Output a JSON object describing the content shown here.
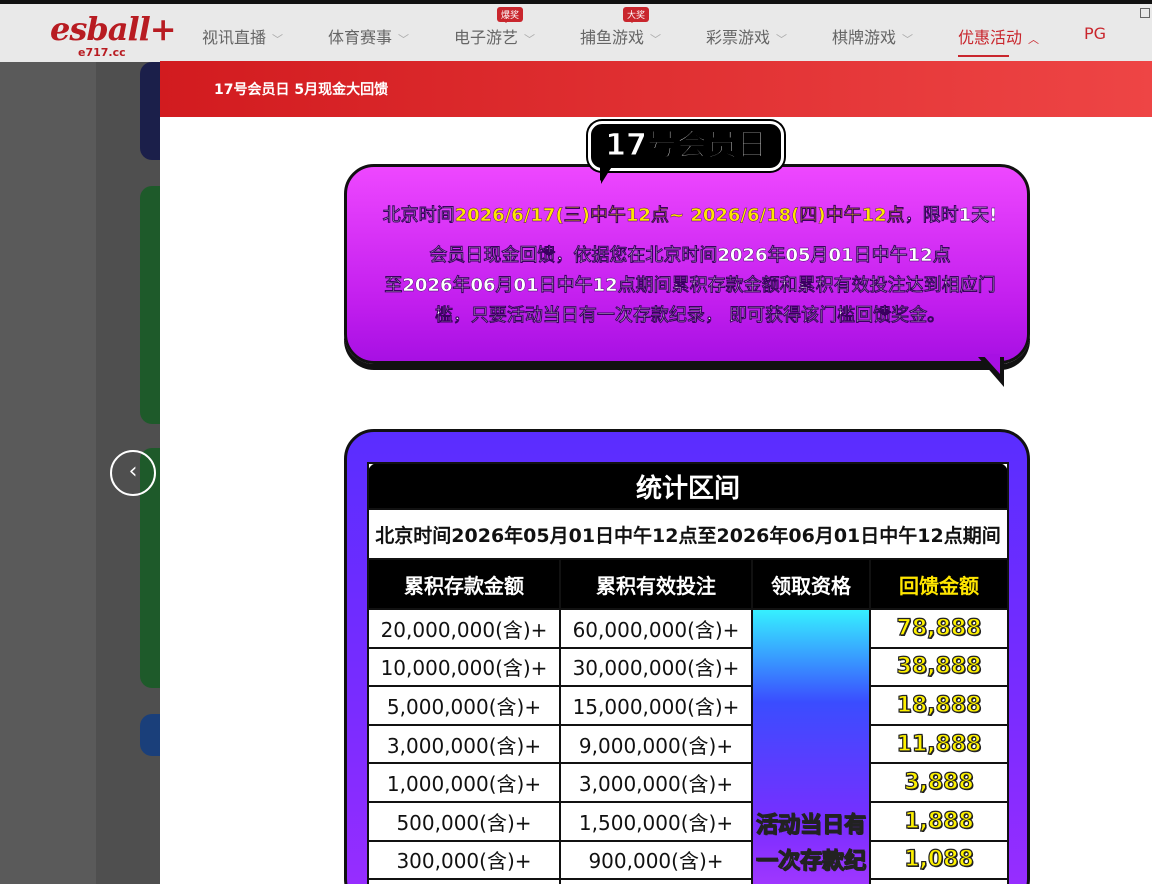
{
  "nav": {
    "brand": "esball+",
    "domain": "e717.cc",
    "items": [
      {
        "label": "视讯直播",
        "badge": ""
      },
      {
        "label": "体育赛事",
        "badge": ""
      },
      {
        "label": "电子游艺",
        "badge": "爆奖"
      },
      {
        "label": "捕鱼游戏",
        "badge": "大奖"
      },
      {
        "label": "彩票游戏",
        "badge": ""
      },
      {
        "label": "棋牌游戏",
        "badge": ""
      },
      {
        "label": "优惠活动",
        "badge": ""
      },
      {
        "label": "PG",
        "badge": ""
      }
    ]
  },
  "modal": {
    "title": "17号会员日 5月现金大回馈",
    "tag": "17号会员日",
    "line1_pre": "北京时间",
    "line1_hl": "2026/6/17(三)中午12点~ 2026/6/18(四)中午12点",
    "line1_post": "，限时1天!",
    "para1": "会员日现金回馈，依据您在北京时间2026年05月01日中午12点",
    "para2": "至2026年06月01日中午12点期间累积存款金额和累积有效投注达到相应门",
    "para3": "槛，只要活动当日有一次存款纪录， 即可获得该门槛回馈奖金。"
  },
  "table": {
    "section": "统计区间",
    "period": "北京时间2026年05月01日中午12点至2026年06月01日中午12点期间",
    "headers": [
      "累积存款金额",
      "累积有效投注",
      "领取资格",
      "回馈金额"
    ],
    "eligibility": "活动当日有一次存款纪录",
    "rows": [
      {
        "deposit": "20,000,000(含)+",
        "bet": "60,000,000(含)+",
        "amount": "78,888"
      },
      {
        "deposit": "10,000,000(含)+",
        "bet": "30,000,000(含)+",
        "amount": "38,888"
      },
      {
        "deposit": "5,000,000(含)+",
        "bet": "15,000,000(含)+",
        "amount": "18,888"
      },
      {
        "deposit": "3,000,000(含)+",
        "bet": "9,000,000(含)+",
        "amount": "11,888"
      },
      {
        "deposit": "1,000,000(含)+",
        "bet": "3,000,000(含)+",
        "amount": "3,888"
      },
      {
        "deposit": "500,000(含)+",
        "bet": "1,500,000(含)+",
        "amount": "1,888"
      },
      {
        "deposit": "300,000(含)+",
        "bet": "900,000(含)+",
        "amount": "1,088"
      },
      {
        "deposit": "",
        "bet": "",
        "amount": ""
      }
    ]
  },
  "colors": {
    "accent": "#c9262d",
    "bubble": "#d42ef5",
    "panel": "#6a2dff",
    "gold": "#fff200"
  }
}
